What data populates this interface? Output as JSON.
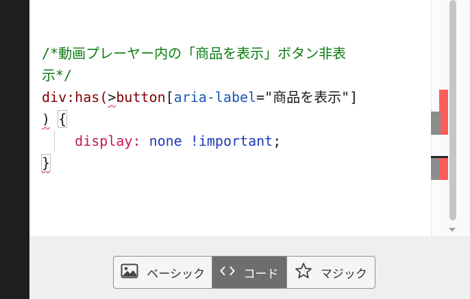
{
  "code_lines": {
    "l1": "/*動画プレーヤー内の「商品を表示」ボタン非表",
    "l2": "示*/",
    "l3_sel1": "div:has(",
    "l3_gt": ">",
    "l3_sel2": "button",
    "l3_br_open": "[",
    "l3_attr": "aria-label",
    "l3_eq": "=",
    "l3_str": "\"商品を表示\"",
    "l3_br_close": "]",
    "l4_paren": ")",
    "l4_space": " ",
    "l4_brace": "{",
    "l5_prop": "display",
    "l5_colon": ": ",
    "l5_val": "none",
    "l5_space": " ",
    "l5_kw": "!important",
    "l5_semi": ";",
    "l6_brace": "}"
  },
  "mode_switch": {
    "basic_label": "ベーシック",
    "code_label": "コード",
    "magic_label": "マジック",
    "selected": "code"
  },
  "icons": {
    "basic": "image-icon",
    "code": "code-brackets-icon",
    "magic": "star-icon"
  },
  "colors": {
    "comment": "#0a7b12",
    "selector": "#800000",
    "attribute": "#1f56b2",
    "property": "#c8184b",
    "value": "#1f39b9",
    "error_marker": "#ff5c5c",
    "selected_segment": "#6e6e6e"
  }
}
